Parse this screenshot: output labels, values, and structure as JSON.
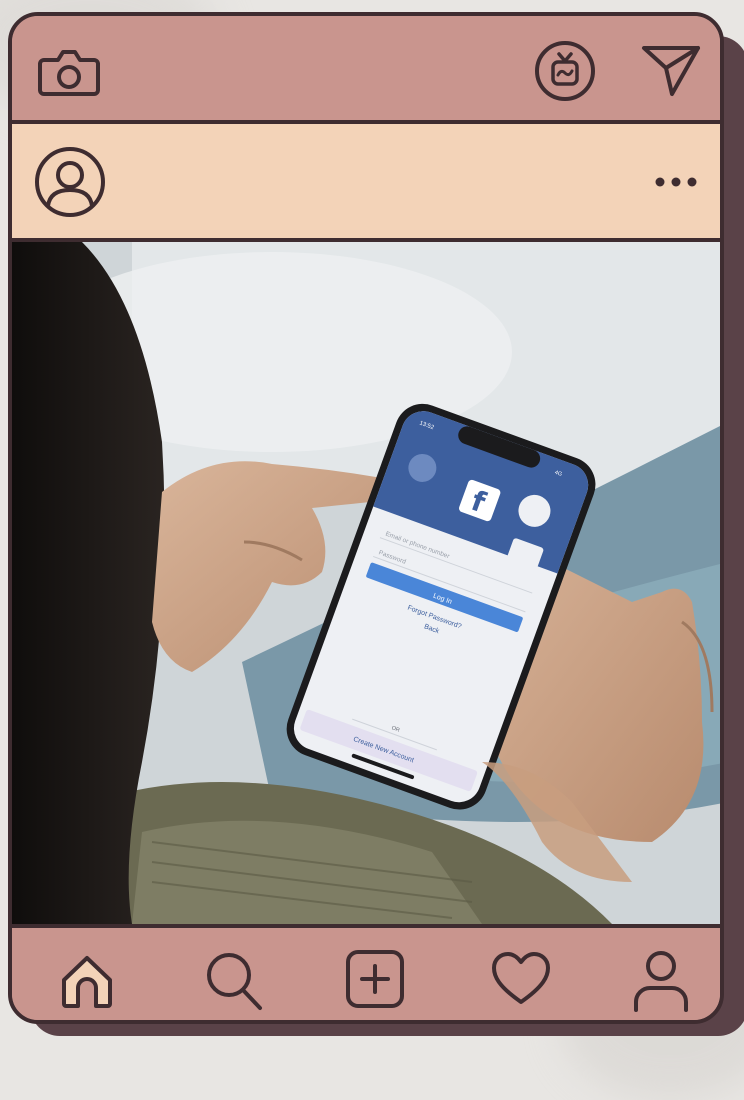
{
  "colors": {
    "frame": "#3e2c30",
    "topbar": "#c9958e",
    "profilebar": "#f3d3b8",
    "shadow": "#5a4248",
    "facebook_blue": "#3b5998",
    "login_button": "#4a86d8"
  },
  "header": {
    "left_icon": "camera-icon",
    "right_icons": [
      "igtv-icon",
      "send-icon"
    ]
  },
  "post": {
    "avatar_icon": "user-avatar-icon",
    "menu_icon": "more-options-icon"
  },
  "phone_screen": {
    "status_time": "13:52",
    "status_right": "4G",
    "logo": "f",
    "email_placeholder": "Email or phone number",
    "password_placeholder": "Password",
    "login_label": "Log In",
    "forgot_label": "Forgot Password?",
    "back_label": "Back",
    "or_label": "OR",
    "create_label": "Create New Account"
  },
  "bottom_nav": {
    "items": [
      "home-icon",
      "search-icon",
      "add-post-icon",
      "heart-icon",
      "profile-icon"
    ]
  }
}
